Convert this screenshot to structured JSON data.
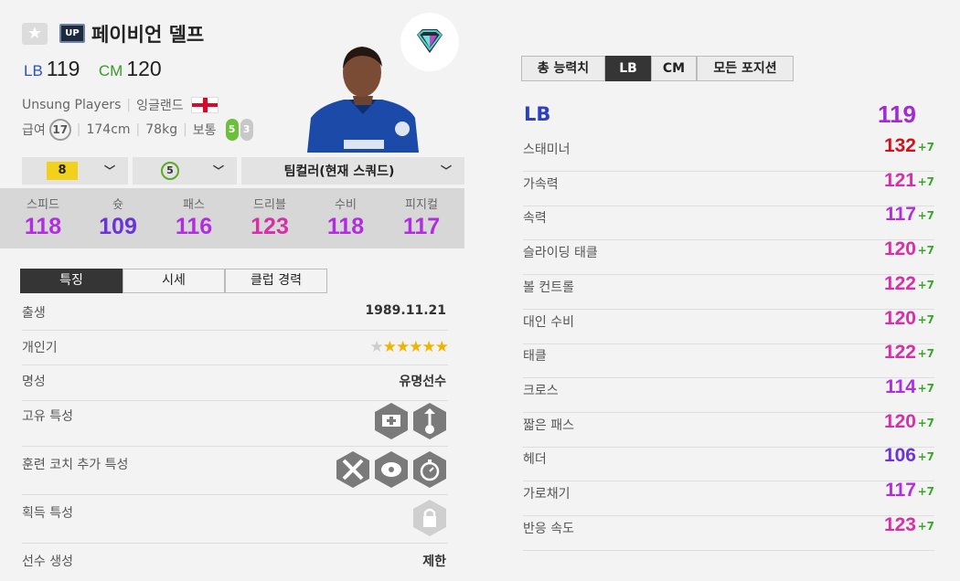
{
  "player": {
    "name": "페이비언 델프",
    "season_badge": "UP",
    "fav_icon": "star-icon",
    "positions": [
      {
        "pos": "LB",
        "ovr": "119"
      },
      {
        "pos": "CM",
        "ovr": "120"
      }
    ],
    "team": "Unsung Players",
    "nation": "잉글랜드",
    "salary_label": "급여",
    "salary": "17",
    "height": "174cm",
    "weight": "78kg",
    "body_type": "보통",
    "foot_left": "5",
    "foot_right": "3"
  },
  "selectors": {
    "enhance": "8",
    "level": "5",
    "squad": "팀컬러(현재 스쿼드)"
  },
  "stats": [
    {
      "label": "스피드",
      "value": "118",
      "color": "#b12ee0"
    },
    {
      "label": "슛",
      "value": "109",
      "color": "#6a34d8"
    },
    {
      "label": "패스",
      "value": "116",
      "color": "#b12ee0"
    },
    {
      "label": "드리블",
      "value": "123",
      "color": "#d62fa8"
    },
    {
      "label": "수비",
      "value": "118",
      "color": "#b12ee0"
    },
    {
      "label": "피지컬",
      "value": "117",
      "color": "#b12ee0"
    }
  ],
  "tabs": [
    "특징",
    "시세",
    "클럽 경력"
  ],
  "details": {
    "birth_label": "출생",
    "birth": "1989.11.21",
    "popularity_label": "개인기",
    "fame_label": "명성",
    "fame": "유명선수",
    "unique_trait_label": "고유 특성",
    "coach_trait_label": "훈련 코치 추가 특성",
    "acquire_trait_label": "획득 특성",
    "create_label": "선수 생성",
    "create": "제한"
  },
  "popularity_stars": {
    "filled": 5,
    "total": 6
  },
  "right_tabs": [
    "총 능력치",
    "LB",
    "CM",
    "모든 포지션"
  ],
  "position_detail": {
    "position": "LB",
    "ovr": "119",
    "rows": [
      {
        "name": "스태미너",
        "value": "132",
        "bonus": "+7",
        "color": "#d4101c"
      },
      {
        "name": "가속력",
        "value": "121",
        "bonus": "+7",
        "color": "#d62fa8"
      },
      {
        "name": "속력",
        "value": "117",
        "bonus": "+7",
        "color": "#b12ee0"
      },
      {
        "name": "슬라이딩 태클",
        "value": "120",
        "bonus": "+7",
        "color": "#d62fa8"
      },
      {
        "name": "볼 컨트롤",
        "value": "122",
        "bonus": "+7",
        "color": "#d62fa8"
      },
      {
        "name": "대인 수비",
        "value": "120",
        "bonus": "+7",
        "color": "#d62fa8"
      },
      {
        "name": "태클",
        "value": "122",
        "bonus": "+7",
        "color": "#d62fa8"
      },
      {
        "name": "크로스",
        "value": "114",
        "bonus": "+7",
        "color": "#b12ee0"
      },
      {
        "name": "짧은 패스",
        "value": "120",
        "bonus": "+7",
        "color": "#d62fa8"
      },
      {
        "name": "헤더",
        "value": "106",
        "bonus": "+7",
        "color": "#6a34d8"
      },
      {
        "name": "가로채기",
        "value": "117",
        "bonus": "+7",
        "color": "#b12ee0"
      },
      {
        "name": "반응 속도",
        "value": "123",
        "bonus": "+7",
        "color": "#d62fa8"
      }
    ]
  }
}
